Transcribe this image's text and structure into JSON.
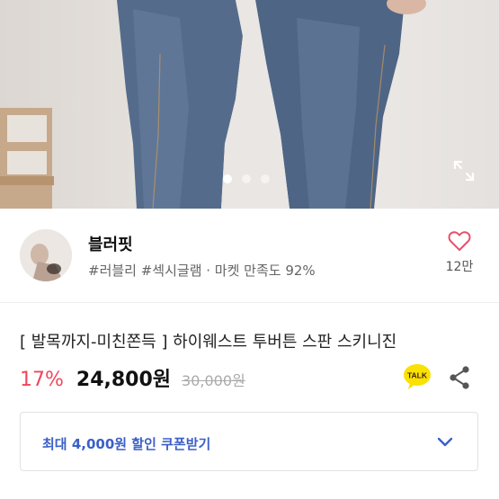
{
  "hero": {
    "dots_total": 3,
    "dot_active_index": 0,
    "expand_icon": "expand-icon"
  },
  "shop": {
    "name": "블러핏",
    "meta": "#러블리 #섹시글램 · 마켓 만족도 92%",
    "like_count": "12만",
    "like_icon": "heart-outline-icon"
  },
  "product": {
    "title": "[ 발목까지-미친쫀득 ] 하이웨스트 투버튼 스판 스키니진",
    "discount": "17%",
    "price": "24,800원",
    "original_price": "30,000원"
  },
  "actions": {
    "talk_label": "TALK",
    "talk_icon": "kakaotalk-icon",
    "share_icon": "share-icon"
  },
  "coupon": {
    "label": "최대 4,000원 할인 쿠폰받기",
    "chevron_icon": "chevron-down-icon"
  },
  "colors": {
    "discount": "#f0475c",
    "coupon_text": "#3b5fc8",
    "like_heart": "#e8506a",
    "talk_yellow": "#fae100"
  }
}
